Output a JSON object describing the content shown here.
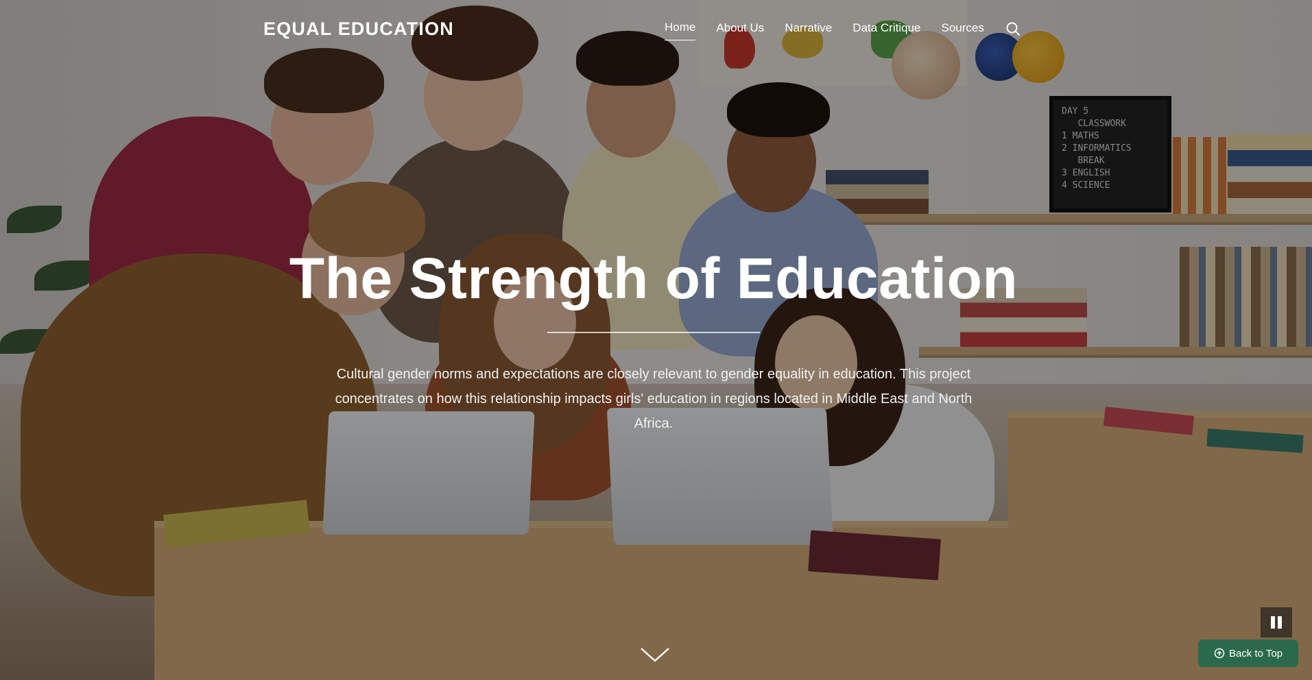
{
  "header": {
    "site_title": "EQUAL EDUCATION",
    "nav": [
      {
        "label": "Home",
        "active": true
      },
      {
        "label": "About Us",
        "active": false
      },
      {
        "label": "Narrative",
        "active": false
      },
      {
        "label": "Data Critique",
        "active": false
      },
      {
        "label": "Sources",
        "active": false
      }
    ],
    "search_icon": "search-icon"
  },
  "hero": {
    "title": "The Strength of Education",
    "description": "Cultural gender norms and expectations are closely relevant to gender equality in education. This project concentrates on how this relationship impacts girls' education in regions located in Middle East and North Africa.",
    "background_board_text": "DAY 5\n   CLASSWORK\n1 MATHS\n2 INFORMATICS\n   BREAK\n3 ENGLISH\n4 SCIENCE"
  },
  "controls": {
    "scroll_icon": "chevron-down-icon",
    "pause_icon": "pause-icon",
    "back_to_top_label": "Back to Top",
    "back_to_top_icon": "arrow-up-circle-icon"
  },
  "colors": {
    "accent": "#2a6a4a",
    "text": "#ffffff"
  }
}
